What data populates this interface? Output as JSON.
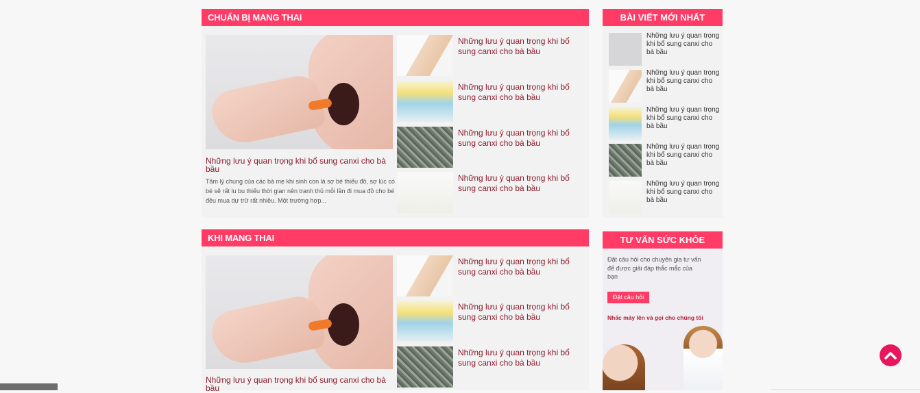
{
  "sections": [
    {
      "title": "CHUẨN BỊ MANG THAI",
      "featured": {
        "title": "Những lưu ý quan trọng khi bổ sung canxi cho bà bầu",
        "excerpt": "Tâm lý chung của các bà mẹ khi sinh con là sợ bé thiếu đồ, sợ lúc có bé sẽ rất lu bu thiếu thời gian nên tranh thủ mỗi lần đi mua đồ cho bé đều mua dự trữ rất nhiều. Một trường hợp..."
      },
      "items": [
        {
          "title": "Những lưu ý quan trọng khi bổ sung canxi cho bà bầu"
        },
        {
          "title": "Những lưu ý quan trọng khi bổ sung canxi cho bà bầu"
        },
        {
          "title": "Những lưu ý quan trọng khi bổ sung canxi cho bà bầu"
        },
        {
          "title": "Những lưu ý quan trọng khi bổ sung canxi cho bà bầu"
        }
      ]
    },
    {
      "title": "KHI MANG THAI",
      "featured": {
        "title": "Những lưu ý quan trọng khi bổ sung canxi cho bà bầu"
      },
      "items": [
        {
          "title": "Những lưu ý quan trọng khi bổ sung canxi cho bà bầu"
        },
        {
          "title": "Những lưu ý quan trọng khi bổ sung canxi cho bà bầu"
        },
        {
          "title": "Những lưu ý quan trọng khi bổ sung canxi cho bà bầu"
        }
      ]
    }
  ],
  "sidebar": {
    "recent": {
      "title": "BÀI VIẾT MỚI NHẤT",
      "items": [
        {
          "title": "Những lưu ý quan trọng khi bổ sung canxi cho bà bầu"
        },
        {
          "title": "Những lưu ý quan trọng khi bổ sung canxi cho bà bầu"
        },
        {
          "title": "Những lưu ý quan trọng khi bổ sung canxi cho bà bầu"
        },
        {
          "title": "Những lưu ý quan trọng khi bổ sung canxi cho bà bầu"
        },
        {
          "title": "Những lưu ý quan trọng khi bổ sung canxi cho bà bầu"
        }
      ]
    },
    "advice": {
      "title": "TƯ VẤN SỨC KHỎE",
      "text": "Đặt câu hỏi cho chuyên gia tư vấn để được giải đáp thắc mắc của bạn",
      "button": "Đặt câu hỏi",
      "call": "Nhấc máy lên và gọi cho chúng tôi"
    }
  },
  "icons": {
    "back_to_top": "chevron-up-icon"
  },
  "colors": {
    "accent": "#ff3b66",
    "title": "#8b1b2c",
    "back_to_top": "#e8175d"
  }
}
